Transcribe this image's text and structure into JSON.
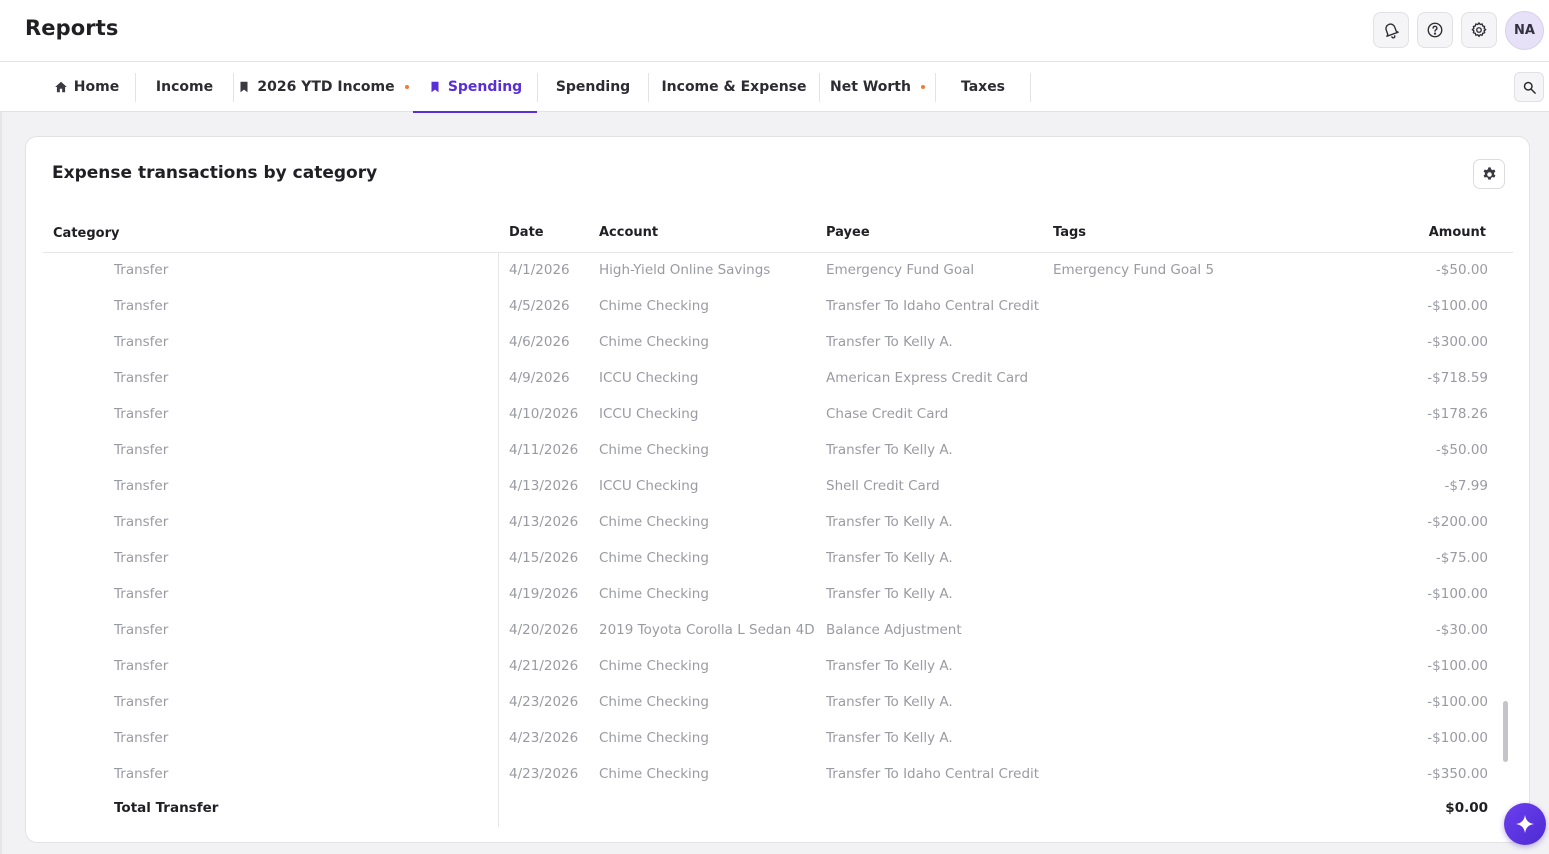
{
  "header": {
    "title": "Reports",
    "user_initials": "NA"
  },
  "tabs": [
    {
      "label": "Home",
      "icon": "home-icon",
      "active": false,
      "dot": false
    },
    {
      "label": "Income",
      "icon": "",
      "active": false,
      "dot": false
    },
    {
      "label": "2026 YTD Income",
      "icon": "bookmark-icon",
      "active": false,
      "dot": true
    },
    {
      "label": "Spending",
      "icon": "bookmark-icon",
      "active": true,
      "dot": false
    },
    {
      "label": "Spending",
      "icon": "",
      "active": false,
      "dot": false
    },
    {
      "label": "Income & Expense",
      "icon": "",
      "active": false,
      "dot": false
    },
    {
      "label": "Net Worth",
      "icon": "",
      "active": false,
      "dot": true
    },
    {
      "label": "Taxes",
      "icon": "",
      "active": false,
      "dot": false
    }
  ],
  "card": {
    "title": "Expense transactions by category",
    "columns": {
      "category": "Category",
      "date": "Date",
      "account": "Account",
      "payee": "Payee",
      "tags": "Tags",
      "amount": "Amount"
    },
    "rows": [
      {
        "category": "Transfer",
        "date": "4/1/2026",
        "account": "High-Yield Online Savings",
        "payee": "Emergency Fund Goal",
        "tags": "Emergency Fund Goal 5",
        "amount": "-$50.00"
      },
      {
        "category": "Transfer",
        "date": "4/5/2026",
        "account": "Chime Checking",
        "payee": "Transfer To Idaho Central Credit U",
        "tags": "",
        "amount": "-$100.00"
      },
      {
        "category": "Transfer",
        "date": "4/6/2026",
        "account": "Chime Checking",
        "payee": "Transfer To Kelly A.",
        "tags": "",
        "amount": "-$300.00"
      },
      {
        "category": "Transfer",
        "date": "4/9/2026",
        "account": "ICCU Checking",
        "payee": "American Express Credit Card",
        "tags": "",
        "amount": "-$718.59"
      },
      {
        "category": "Transfer",
        "date": "4/10/2026",
        "account": "ICCU Checking",
        "payee": "Chase Credit Card",
        "tags": "",
        "amount": "-$178.26"
      },
      {
        "category": "Transfer",
        "date": "4/11/2026",
        "account": "Chime Checking",
        "payee": "Transfer To Kelly A.",
        "tags": "",
        "amount": "-$50.00"
      },
      {
        "category": "Transfer",
        "date": "4/13/2026",
        "account": "ICCU Checking",
        "payee": "Shell Credit Card",
        "tags": "",
        "amount": "-$7.99"
      },
      {
        "category": "Transfer",
        "date": "4/13/2026",
        "account": "Chime Checking",
        "payee": "Transfer To Kelly A.",
        "tags": "",
        "amount": "-$200.00"
      },
      {
        "category": "Transfer",
        "date": "4/15/2026",
        "account": "Chime Checking",
        "payee": "Transfer To Kelly A.",
        "tags": "",
        "amount": "-$75.00"
      },
      {
        "category": "Transfer",
        "date": "4/19/2026",
        "account": "Chime Checking",
        "payee": "Transfer To Kelly A.",
        "tags": "",
        "amount": "-$100.00"
      },
      {
        "category": "Transfer",
        "date": "4/20/2026",
        "account": "2019 Toyota Corolla L Sedan 4D",
        "payee": "Balance Adjustment",
        "tags": "",
        "amount": "-$30.00"
      },
      {
        "category": "Transfer",
        "date": "4/21/2026",
        "account": "Chime Checking",
        "payee": "Transfer To Kelly A.",
        "tags": "",
        "amount": "-$100.00"
      },
      {
        "category": "Transfer",
        "date": "4/23/2026",
        "account": "Chime Checking",
        "payee": "Transfer To Kelly A.",
        "tags": "",
        "amount": "-$100.00"
      },
      {
        "category": "Transfer",
        "date": "4/23/2026",
        "account": "Chime Checking",
        "payee": "Transfer To Kelly A.",
        "tags": "",
        "amount": "-$100.00"
      },
      {
        "category": "Transfer",
        "date": "4/23/2026",
        "account": "Chime Checking",
        "payee": "Transfer To Idaho Central Credit U",
        "tags": "",
        "amount": "-$350.00"
      }
    ],
    "total": {
      "label": "Total Transfer",
      "amount": "$0.00"
    }
  },
  "colors": {
    "accent": "#5a2fd6",
    "dot": "#f07a3a",
    "muted_text": "#9a9aa3"
  }
}
